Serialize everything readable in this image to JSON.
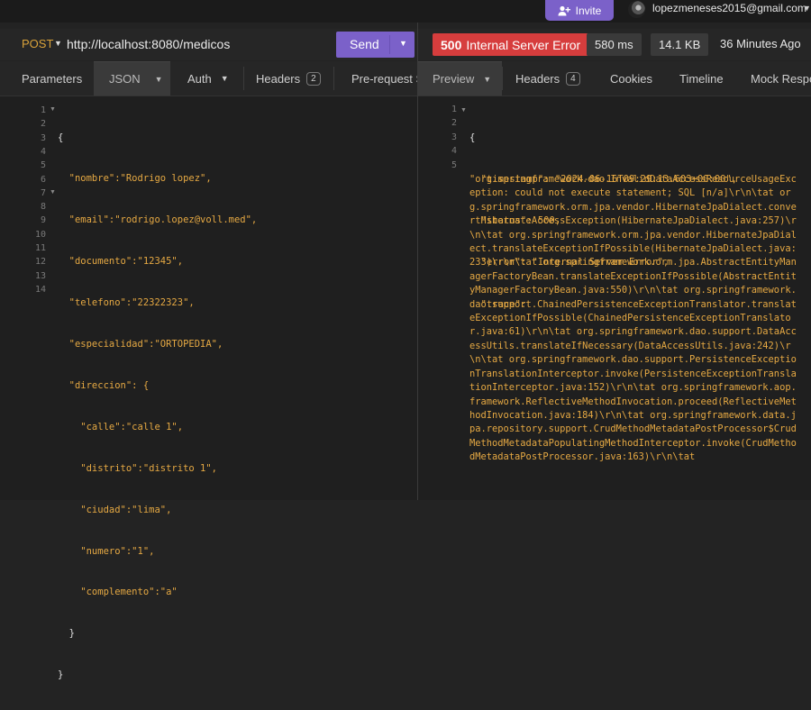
{
  "topbar": {
    "invite_label": "Invite",
    "user_email": "lopezmeneses2015@gmail.com"
  },
  "request": {
    "method": "POST",
    "url": "http://localhost:8080/medicos",
    "send_label": "Send",
    "tabs": [
      {
        "label": "Parameters"
      },
      {
        "label": "JSON"
      },
      {
        "label": "Auth"
      },
      {
        "label": "Headers",
        "badge": "2"
      },
      {
        "label": "Pre-request S"
      }
    ],
    "line_numbers": [
      "1",
      "2",
      "3",
      "4",
      "5",
      "6",
      "7",
      "8",
      "9",
      "10",
      "11",
      "12",
      "13",
      "14"
    ],
    "body_lines": [
      "{",
      "  \"nombre\":\"Rodrigo lopez\",",
      "  \"email\":\"rodrigo.lopez@voll.med\",",
      "  \"documento\":\"12345\",",
      "  \"telefono\":\"22322323\",",
      "  \"especialidad\":\"ORTOPEDIA\",",
      "  \"direccion\": {",
      "    \"calle\":\"calle 1\",",
      "    \"distrito\":\"distrito 1\",",
      "    \"ciudad\":\"lima\",",
      "    \"numero\":\"1\",",
      "    \"complemento\":\"a\"",
      "  }",
      "}"
    ]
  },
  "response": {
    "status_code": "500",
    "status_text": "Internal Server Error",
    "time": "580 ms",
    "size": "14.1 KB",
    "age": "36 Minutes Ago",
    "tabs": [
      {
        "label": "Preview"
      },
      {
        "label": "Headers",
        "badge": "4"
      },
      {
        "label": "Cookies"
      },
      {
        "label": "Timeline"
      },
      {
        "label": "Mock Respo"
      }
    ],
    "line_numbers": [
      "1",
      "2",
      "3",
      "4",
      "5"
    ],
    "lines": [
      "{",
      "  \"timestamp\": \"2024-06-16T09:29:13.603+00:00\",",
      "  \"status\": 500,",
      "  \"error\": \"Internal Server Error\",",
      "  \"trace\":"
    ],
    "trace": "\"org.springframework.dao.InvalidDataAccessResourceUsageException: could not execute statement; SQL [n/a]\\r\\n\\tat org.springframework.orm.jpa.vendor.HibernateJpaDialect.convertHibernateAccessException(HibernateJpaDialect.java:257)\\r\\n\\tat org.springframework.orm.jpa.vendor.HibernateJpaDialect.translateExceptionIfPossible(HibernateJpaDialect.java:233)\\r\\n\\tat org.springframework.orm.jpa.AbstractEntityManagerFactoryBean.translateExceptionIfPossible(AbstractEntityManagerFactoryBean.java:550)\\r\\n\\tat org.springframework.dao.support.ChainedPersistenceExceptionTranslator.translateExceptionIfPossible(ChainedPersistenceExceptionTranslator.java:61)\\r\\n\\tat org.springframework.dao.support.DataAccessUtils.translateIfNecessary(DataAccessUtils.java:242)\\r\\n\\tat org.springframework.dao.support.PersistenceExceptionTranslationInterceptor.invoke(PersistenceExceptionTranslationInterceptor.java:152)\\r\\n\\tat org.springframework.aop.framework.ReflectiveMethodInvocation.proceed(ReflectiveMethodInvocation.java:184)\\r\\n\\tat org.springframework.data.jpa.repository.support.CrudMethodMetadataPostProcessor$CrudMethodMetadataPopulatingMethodInterceptor.invoke(CrudMethodMetadataPostProcessor.java:163)\\r\\n\\tat"
  },
  "colors": {
    "accent": "#7b61c9",
    "error": "#d63d3d",
    "json_string": "#e6a943"
  }
}
